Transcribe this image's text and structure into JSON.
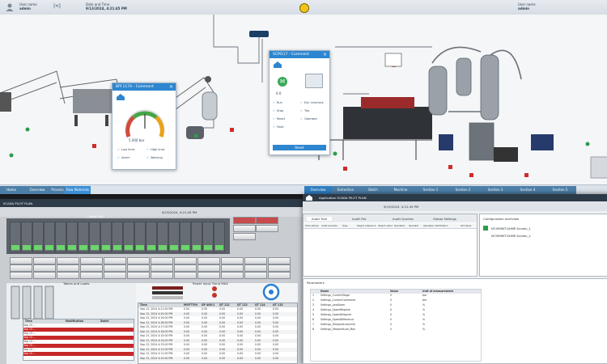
{
  "top_screen": {
    "header": {
      "session_label": "User name",
      "session_value": "admin",
      "date_label": "Date and Time",
      "datetime": "9/13/2024, 4:21:45 PM",
      "logout_label": "User name",
      "logout_value": "admin"
    },
    "faceplate_left": {
      "title": "BPI 117A - Comment",
      "gauge_value": "5.000 bar",
      "rows": [
        "Low limit",
        "High limit",
        "Alarm",
        "Warning"
      ]
    },
    "faceplate_right": {
      "title": "SCM117 - Comment",
      "status_letter": "M",
      "value": "0.0",
      "rows": [
        "Run",
        "Stop",
        "Reset",
        "Fault",
        "Ext. interlock",
        "Trip",
        "Operator"
      ],
      "button_label": "Reset"
    },
    "nav_tabs": [
      {
        "label": "Home"
      },
      {
        "label": "Overview"
      },
      {
        "label": "Process"
      },
      {
        "label": "Raw Materials"
      },
      {
        "label": "Overview"
      },
      {
        "label": "Extraction"
      },
      {
        "label": "Batch"
      },
      {
        "label": "Machine"
      },
      {
        "label": "Section 1"
      },
      {
        "label": "Section 2"
      },
      {
        "label": "Section 3"
      },
      {
        "label": "Section 4"
      },
      {
        "label": "Section 5"
      }
    ]
  },
  "bottom_left_screen": {
    "header": "SCADA PILOT PLAN",
    "datetime": "9/13/2024, 4:21:45 PM",
    "panel_title": "Cutter Mill",
    "table_title": "Tables and Loads",
    "trend_title": "Power Input Trend MAX",
    "table_columns": [
      "Time",
      "MVP7709",
      "GP 408-1",
      "QT 112",
      "QT 113",
      "QT 114",
      "QT 115"
    ],
    "table_rows": [
      [
        "Sep 13, 2024 4:21:00 PM",
        "0.00",
        "0.00",
        "0.00",
        "0.00",
        "0.00",
        "0.00"
      ],
      [
        "Sep 13, 2024 4:20:00 PM",
        "0.00",
        "0.00",
        "0.00",
        "0.00",
        "0.00",
        "0.00"
      ],
      [
        "Sep 13, 2024 4:19:00 PM",
        "0.00",
        "0.00",
        "0.00",
        "0.00",
        "0.00",
        "0.00"
      ],
      [
        "Sep 13, 2024 4:18:00 PM",
        "0.00",
        "0.00",
        "0.00",
        "0.00",
        "0.00",
        "0.00"
      ],
      [
        "Sep 13, 2024 4:17:00 PM",
        "0.00",
        "0.00",
        "0.00",
        "0.00",
        "0.00",
        "0.00"
      ],
      [
        "Sep 13, 2024 4:16:00 PM",
        "0.00",
        "0.00",
        "0.00",
        "0.00",
        "0.00",
        "0.00"
      ],
      [
        "Sep 13, 2024 4:15:00 PM",
        "0.00",
        "0.00",
        "0.00",
        "0.00",
        "0.00",
        "0.00"
      ],
      [
        "Sep 13, 2024 4:14:00 PM",
        "0.00",
        "0.00",
        "0.00",
        "0.00",
        "0.00",
        "0.00"
      ],
      [
        "Sep 13, 2024 4:13:00 PM",
        "0.00",
        "0.00",
        "0.00",
        "0.00",
        "0.00",
        "0.00"
      ],
      [
        "Sep 13, 2024 4:12:00 PM",
        "0.00",
        "0.00",
        "0.00",
        "0.00",
        "0.00",
        "0.00"
      ],
      [
        "Sep 13, 2024 4:11:00 PM",
        "0.00",
        "0.00",
        "0.00",
        "0.00",
        "0.00",
        "0.00"
      ],
      [
        "Sep 13, 2024 4:10:00 PM",
        "0.00",
        "0.00",
        "0.00",
        "0.00",
        "0.00",
        "0.00"
      ]
    ],
    "left_table_columns": [
      "Time",
      "Modification",
      "Batch"
    ],
    "left_rows": [
      "Sep 13 ...",
      "Sep 13 ...",
      "Sep 13 ...",
      "Sep 13 ...",
      "Sep 13 ...",
      "Sep 13 ...",
      "Sep 13 ...",
      "Sep 13 ..."
    ]
  },
  "bottom_right_screen": {
    "app_title": "Application SCADA PILOT PLAN",
    "datetime": "9/13/2024, 4:21:45 PM",
    "tabs": [
      {
        "label": "Audit Trail"
      },
      {
        "label": "Audit File"
      },
      {
        "label": "Audit Queries"
      },
      {
        "label": "Global Settings"
      }
    ],
    "filter_columns": [
      "Time stamp",
      "Audit provider",
      "Type",
      "Object reference",
      "Object name",
      "Operation",
      "Operator",
      "Operation Verification",
      "Old Value"
    ],
    "side_panel_title": "Configuration overview",
    "side_items": [
      "NT-MMMT-SHMP-Screen_1",
      "NT-MMMT-SHMP-Screen_2"
    ],
    "params_title": "Parameters",
    "param_columns": [
      "",
      "Name",
      "Value",
      "Unit of measurement"
    ],
    "param_rows": [
      [
        "1",
        "Settings_CurrentStage",
        "0",
        "bar"
      ],
      [
        "2",
        "Settings_CurrentCommand",
        "0",
        "bar"
      ],
      [
        "3",
        "Settings_LowAlarm",
        "0",
        "%"
      ],
      [
        "4",
        "Settings_SpeedRegime",
        "0",
        "%"
      ],
      [
        "5",
        "Settings_SpeedSetpoint",
        "0",
        "%"
      ],
      [
        "6",
        "Settings_SpeedDifference",
        "0",
        "%"
      ],
      [
        "7",
        "Settings_TemperatureLimit",
        "0",
        "%"
      ],
      [
        "8",
        "Settings_Temperature_Max",
        "0",
        "%"
      ]
    ]
  }
}
